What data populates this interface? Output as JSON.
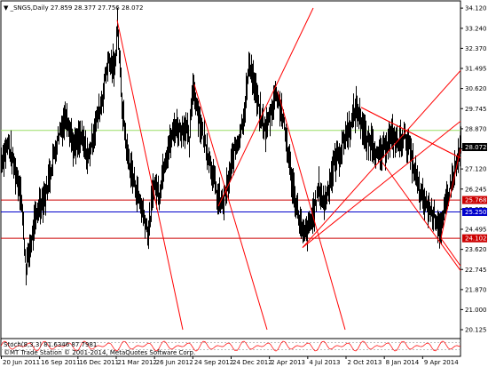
{
  "header": {
    "symbol_line": "▼ _SNGS,Daily  27.859 28.377 27.756 28.072"
  },
  "indicator": {
    "label": "Stoch(8,3,3) 81.6346 87.7981",
    "range": [
      0,
      100
    ],
    "levels": [
      20,
      80
    ]
  },
  "footer": {
    "copyright": "©MT Trade Station © 2001-2014, MetaQuotes Software Corp."
  },
  "colors": {
    "background": "#ffffff",
    "price_bars": "#000000",
    "trendlines": "#ff0000",
    "green_level": "#99dd66",
    "blue_level": "#0000cc",
    "red_level": "#cc0000",
    "stoch_line": "#ff0000"
  },
  "chart_data": {
    "type": "candlestick",
    "symbol": "_SNGS",
    "timeframe": "Daily",
    "ohlc_last": {
      "open": 27.859,
      "high": 28.377,
      "low": 27.756,
      "close": 28.072
    },
    "ylim": [
      20.125,
      34.125
    ],
    "y_ticks": [
      "34.120",
      "33.240",
      "32.370",
      "31.495",
      "30.620",
      "29.745",
      "28.870",
      "27.995",
      "27.120",
      "26.245",
      "25.370",
      "24.495",
      "23.620",
      "22.745",
      "21.870",
      "21.000",
      "20.125"
    ],
    "x_ticks": [
      "20 Jun 2011",
      "16 Sep 2011",
      "16 Dec 2011",
      "21 Mar 2012",
      "26 Jun 2012",
      "24 Sep 2012",
      "24 Dec 2012",
      "2 Apr 2013",
      "4 Jul 2013",
      "2 Oct 2013",
      "8 Jan 2014",
      "9 Apr 2014"
    ],
    "close_profile": [
      [
        0,
        27.5
      ],
      [
        8,
        28.2
      ],
      [
        16,
        27.0
      ],
      [
        22,
        26.2
      ],
      [
        28,
        22.8
      ],
      [
        34,
        24.0
      ],
      [
        42,
        25.5
      ],
      [
        50,
        26.0
      ],
      [
        58,
        27.5
      ],
      [
        66,
        28.8
      ],
      [
        74,
        29.5
      ],
      [
        82,
        28.0
      ],
      [
        90,
        28.5
      ],
      [
        98,
        27.6
      ],
      [
        106,
        29.0
      ],
      [
        114,
        30.2
      ],
      [
        120,
        31.8
      ],
      [
        128,
        31.5
      ],
      [
        131,
        33.6
      ],
      [
        136,
        30.0
      ],
      [
        142,
        27.8
      ],
      [
        148,
        26.8
      ],
      [
        154,
        26.0
      ],
      [
        160,
        25.2
      ],
      [
        166,
        24.3
      ],
      [
        172,
        26.5
      ],
      [
        178,
        26.0
      ],
      [
        184,
        27.5
      ],
      [
        190,
        28.2
      ],
      [
        196,
        29.0
      ],
      [
        202,
        28.8
      ],
      [
        208,
        29.0
      ],
      [
        212,
        28.2
      ],
      [
        216,
        30.8
      ],
      [
        220,
        30.0
      ],
      [
        226,
        28.8
      ],
      [
        232,
        28.0
      ],
      [
        238,
        27.0
      ],
      [
        244,
        25.8
      ],
      [
        250,
        25.6
      ],
      [
        256,
        26.5
      ],
      [
        262,
        27.8
      ],
      [
        268,
        28.5
      ],
      [
        274,
        29.6
      ],
      [
        280,
        31.8
      ],
      [
        286,
        30.6
      ],
      [
        292,
        29.4
      ],
      [
        298,
        28.8
      ],
      [
        304,
        29.6
      ],
      [
        310,
        30.5
      ],
      [
        316,
        29.6
      ],
      [
        322,
        28.2
      ],
      [
        328,
        26.5
      ],
      [
        334,
        25.3
      ],
      [
        340,
        24.2
      ],
      [
        346,
        24.5
      ],
      [
        352,
        25.2
      ],
      [
        358,
        26.3
      ],
      [
        364,
        25.6
      ],
      [
        370,
        26.5
      ],
      [
        376,
        27.5
      ],
      [
        382,
        27.8
      ],
      [
        388,
        28.6
      ],
      [
        394,
        29.0
      ],
      [
        400,
        29.8
      ],
      [
        406,
        29.2
      ],
      [
        412,
        28.2
      ],
      [
        418,
        28.4
      ],
      [
        424,
        27.6
      ],
      [
        430,
        27.8
      ],
      [
        436,
        28.4
      ],
      [
        442,
        28.5
      ],
      [
        448,
        28.2
      ],
      [
        454,
        28.6
      ],
      [
        460,
        28.0
      ],
      [
        466,
        27.0
      ],
      [
        472,
        26.0
      ],
      [
        478,
        25.6
      ],
      [
        484,
        25.3
      ],
      [
        490,
        25.0
      ],
      [
        496,
        24.4
      ],
      [
        502,
        25.8
      ],
      [
        508,
        26.6
      ],
      [
        514,
        27.4
      ],
      [
        518,
        28.1
      ]
    ],
    "horizontal_levels": [
      {
        "price": 28.8,
        "color": "#99dd66",
        "label": ""
      },
      {
        "price": 25.768,
        "color": "#cc0000",
        "label": "25.768"
      },
      {
        "price": 25.25,
        "color": "#0000cc",
        "label": "25.250"
      },
      {
        "price": 24.102,
        "color": "#cc0000",
        "label": "24.102"
      }
    ],
    "price_tag": {
      "price": 28.072,
      "label": "28.072",
      "color": "#000000"
    },
    "trendlines": [
      [
        [
          131,
          33.6
        ],
        [
          205,
          20.125
        ]
      ],
      [
        [
          218,
          30.8
        ],
        [
          300,
          20.125
        ]
      ],
      [
        [
          312,
          30.5
        ],
        [
          388,
          20.125
        ]
      ],
      [
        [
          340,
          23.7
        ],
        [
          518,
          29.2
        ]
      ],
      [
        [
          340,
          23.7
        ],
        [
          518,
          31.4
        ]
      ],
      [
        [
          406,
          29.8
        ],
        [
          518,
          27.6
        ]
      ],
      [
        [
          406,
          29.8
        ],
        [
          518,
          27.6
        ]
      ],
      [
        [
          496,
          24.1
        ],
        [
          518,
          28.0
        ]
      ],
      [
        [
          496,
          24.1
        ],
        [
          518,
          22.9
        ]
      ],
      [
        [
          245,
          25.5
        ],
        [
          352,
          34.125
        ]
      ],
      [
        [
          430,
          27.4
        ],
        [
          518,
          22.7
        ]
      ]
    ]
  }
}
